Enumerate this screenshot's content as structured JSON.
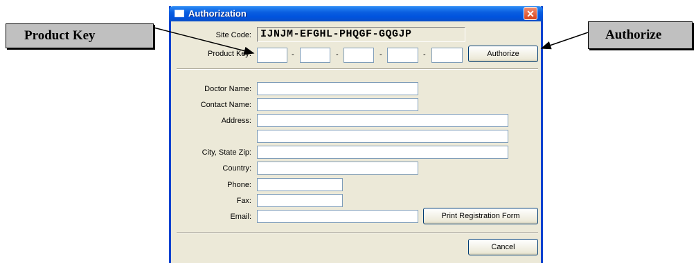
{
  "callouts": {
    "left": "Product Key",
    "right": "Authorize"
  },
  "window": {
    "title": "Authorization",
    "close_glyph": "✕"
  },
  "site_code": {
    "label": "Site Code:",
    "value": "IJNJM-EFGHL-PHQGF-GQGJP"
  },
  "product_key": {
    "label": "Product Key:",
    "separator": "-",
    "segments": [
      "",
      "",
      "",
      "",
      ""
    ]
  },
  "buttons": {
    "authorize": "Authorize",
    "print": "Print Registration Form",
    "cancel": "Cancel"
  },
  "form": {
    "doctor_name": "Doctor Name:",
    "contact_name": "Contact Name:",
    "address": "Address:",
    "city_state_zip": "City, State Zip:",
    "country": "Country:",
    "phone": "Phone:",
    "fax": "Fax:",
    "email": "Email:"
  }
}
